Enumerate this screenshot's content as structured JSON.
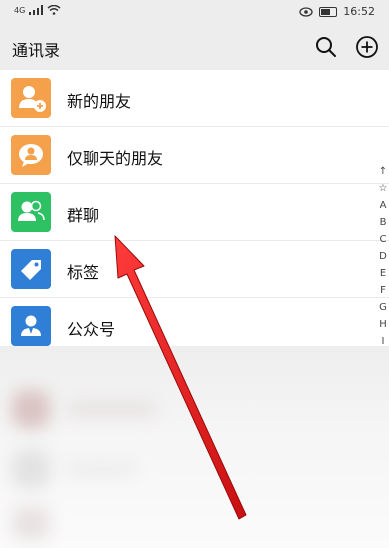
{
  "status_bar": {
    "network": "4G",
    "time": "16:52"
  },
  "header": {
    "title": "通讯录",
    "search_icon": "search-icon",
    "add_icon": "plus-circle-icon"
  },
  "contacts_menu": [
    {
      "label": "新的朋友",
      "color": "#f5a04a",
      "icon": "add-person-icon"
    },
    {
      "label": "仅聊天的朋友",
      "color": "#f5a04a",
      "icon": "chat-person-icon"
    },
    {
      "label": "群聊",
      "color": "#2ec164",
      "icon": "group-icon"
    },
    {
      "label": "标签",
      "color": "#2f7fd6",
      "icon": "tag-icon"
    },
    {
      "label": "公众号",
      "color": "#2f7fd6",
      "icon": "official-account-icon"
    }
  ],
  "index_bar": [
    "↑",
    "☆",
    "A",
    "B",
    "C",
    "D",
    "E",
    "F",
    "G",
    "H",
    "I"
  ],
  "annotation": {
    "arrow_color": "#e02020"
  }
}
